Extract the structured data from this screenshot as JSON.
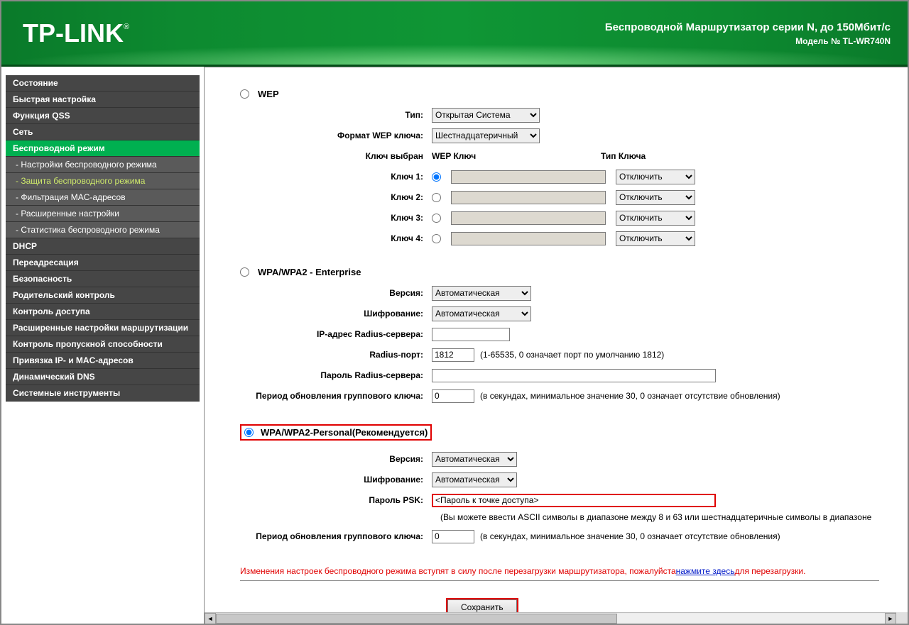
{
  "header": {
    "logo": "TP-LINK",
    "title": "Беспроводной Маршрутизатор серии N, до 150Мбит/с",
    "model": "Модель № TL-WR740N"
  },
  "sidebar": [
    {
      "label": "Состояние",
      "type": "top"
    },
    {
      "label": "Быстрая настройка",
      "type": "top"
    },
    {
      "label": "Функция QSS",
      "type": "top"
    },
    {
      "label": "Сеть",
      "type": "top"
    },
    {
      "label": "Беспроводной режим",
      "type": "active"
    },
    {
      "label": "- Настройки беспроводного режима",
      "type": "sub"
    },
    {
      "label": "- Защита беспроводного режима",
      "type": "sub-current"
    },
    {
      "label": "- Фильтрация MAC-адресов",
      "type": "sub"
    },
    {
      "label": "- Расширенные настройки",
      "type": "sub"
    },
    {
      "label": "- Статистика беспроводного режима",
      "type": "sub"
    },
    {
      "label": "DHCP",
      "type": "top"
    },
    {
      "label": "Переадресация",
      "type": "top"
    },
    {
      "label": "Безопасность",
      "type": "top"
    },
    {
      "label": "Родительский контроль",
      "type": "top"
    },
    {
      "label": "Контроль доступа",
      "type": "top"
    },
    {
      "label": "Расширенные настройки маршрутизации",
      "type": "top"
    },
    {
      "label": "Контроль пропускной способности",
      "type": "top"
    },
    {
      "label": "Привязка IP- и MAC-адресов",
      "type": "top"
    },
    {
      "label": "Динамический DNS",
      "type": "top"
    },
    {
      "label": "Системные инструменты",
      "type": "top"
    }
  ],
  "wep": {
    "title": "WEP",
    "type_label": "Тип:",
    "type_value": "Открытая Система",
    "format_label": "Формат WEP ключа:",
    "format_value": "Шестнадцатеричный",
    "selected_label": "Ключ выбран",
    "key_header": "WEP Ключ",
    "keytype_header": "Тип Ключа",
    "rows": [
      {
        "label": "Ключ 1:",
        "sel": "Отключить"
      },
      {
        "label": "Ключ 2:",
        "sel": "Отключить"
      },
      {
        "label": "Ключ 3:",
        "sel": "Отключить"
      },
      {
        "label": "Ключ 4:",
        "sel": "Отключить"
      }
    ]
  },
  "enterprise": {
    "title": "WPA/WPA2 - Enterprise",
    "version_label": "Версия:",
    "version_value": "Автоматическая",
    "encryption_label": "Шифрование:",
    "encryption_value": "Автоматическая",
    "radius_ip_label": "IP-адрес Radius-сервера:",
    "radius_ip_value": "",
    "radius_port_label": "Radius-порт:",
    "radius_port_value": "1812",
    "radius_port_hint": "(1-65535, 0 означает порт по умолчанию 1812)",
    "radius_pass_label": "Пароль Radius-сервера:",
    "radius_pass_value": "",
    "group_label": "Период обновления группового ключа:",
    "group_value": "0",
    "group_hint": "(в секундах, минимальное значение 30, 0 означает отсутствие обновления)"
  },
  "personal": {
    "title": "WPA/WPA2-Personal(Рекомендуется)",
    "version_label": "Версия:",
    "version_value": "Автоматическая",
    "encryption_label": "Шифрование:",
    "encryption_value": "Автоматическая",
    "psk_label": "Пароль PSK:",
    "psk_value": "<Пароль к точке доступа>",
    "psk_hint": "(Вы можете ввести ASCII символы в диапазоне между 8 и 63 или шестнадцатеричные символы в диапазоне",
    "group_label": "Период обновления группового ключа:",
    "group_value": "0",
    "group_hint": "(в секундах, минимальное значение 30, 0 означает отсутствие обновления)"
  },
  "notice": {
    "text_before": "Изменения настроек беспроводного режима вступят в силу после перезагрузки маршрутизатора, пожалуйста",
    "link": "нажмите здесь",
    "text_after": "для перезагрузки."
  },
  "save_label": "Сохранить"
}
